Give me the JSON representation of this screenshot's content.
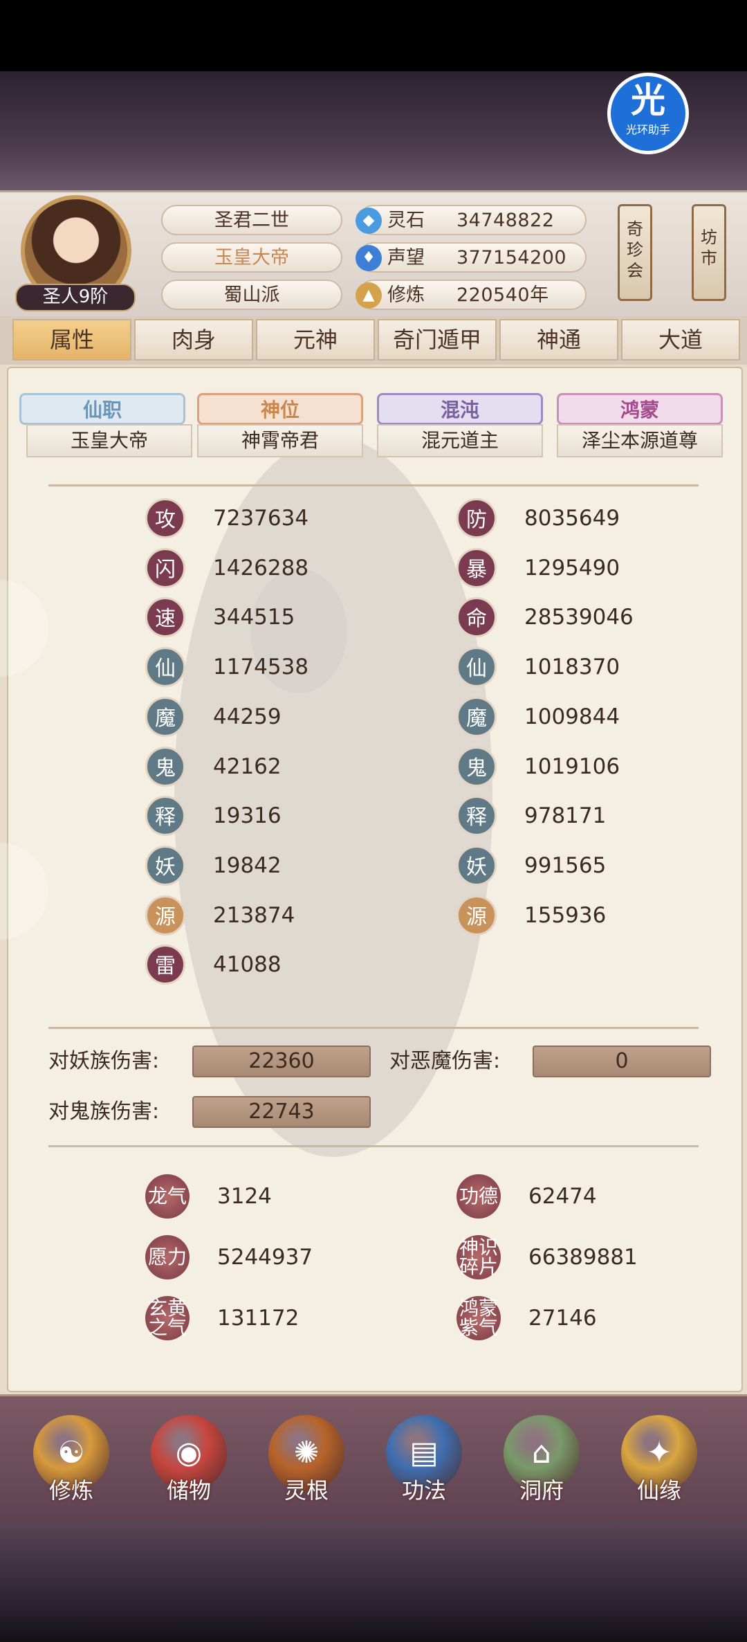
{
  "player": {
    "rank": "圣人9阶",
    "name_line1": "圣君二世",
    "name_line2": "玉皇大帝",
    "sect": "蜀山派"
  },
  "resources": [
    {
      "label": "灵石",
      "value": "34748822",
      "icon": "spirit-stone-icon",
      "color": "#4a9be0"
    },
    {
      "label": "声望",
      "value": "377154200",
      "icon": "reputation-icon",
      "color": "#3d7fd6"
    },
    {
      "label": "修炼",
      "value": "220540年",
      "icon": "cultivation-icon",
      "color": "#d4a24c"
    }
  ],
  "side_buttons": {
    "treasure": "奇珍会",
    "market": "坊市"
  },
  "badge": {
    "char": "光",
    "caption": "光环助手"
  },
  "tabs": [
    "属性",
    "肉身",
    "元神",
    "奇门遁甲",
    "神通",
    "大道"
  ],
  "titles": [
    {
      "label": "仙职",
      "value": "玉皇大帝",
      "color": "#6b95b8"
    },
    {
      "label": "神位",
      "value": "神霄帝君",
      "color": "#c9874f"
    },
    {
      "label": "混沌",
      "value": "混元道主",
      "color": "#7a5fa0"
    },
    {
      "label": "鸿蒙",
      "value": "泽尘本源道尊",
      "color": "#a24a8c"
    }
  ],
  "stats_left": [
    {
      "icon": "攻",
      "value": "7237634",
      "color": "#7a3a4f"
    },
    {
      "icon": "闪",
      "value": "1426288",
      "color": "#7a3a4f"
    },
    {
      "icon": "速",
      "value": "344515",
      "color": "#7a3a4f"
    },
    {
      "icon": "仙",
      "value": "1174538",
      "color": "#5f7a86"
    },
    {
      "icon": "魔",
      "value": "44259",
      "color": "#5f7a86"
    },
    {
      "icon": "鬼",
      "value": "42162",
      "color": "#5f7a86"
    },
    {
      "icon": "释",
      "value": "19316",
      "color": "#5f7a86"
    },
    {
      "icon": "妖",
      "value": "19842",
      "color": "#5f7a86"
    },
    {
      "icon": "源",
      "value": "213874",
      "color": "#c9925a"
    },
    {
      "icon": "雷",
      "value": "41088",
      "color": "#7a3a4f"
    }
  ],
  "stats_right": [
    {
      "icon": "防",
      "value": "8035649",
      "color": "#7a3a4f"
    },
    {
      "icon": "暴",
      "value": "1295490",
      "color": "#7a3a4f"
    },
    {
      "icon": "命",
      "value": "28539046",
      "color": "#7a3a4f"
    },
    {
      "icon": "仙",
      "value": "1018370",
      "color": "#5f7a86"
    },
    {
      "icon": "魔",
      "value": "1009844",
      "color": "#5f7a86"
    },
    {
      "icon": "鬼",
      "value": "1019106",
      "color": "#5f7a86"
    },
    {
      "icon": "释",
      "value": "978171",
      "color": "#5f7a86"
    },
    {
      "icon": "妖",
      "value": "991565",
      "color": "#5f7a86"
    },
    {
      "icon": "源",
      "value": "155936",
      "color": "#c9925a"
    }
  ],
  "damage": [
    {
      "label": "对妖族伤害:",
      "value": "22360"
    },
    {
      "label": "对恶魔伤害:",
      "value": "0"
    },
    {
      "label": "对鬼族伤害:",
      "value": "22743"
    }
  ],
  "misc_left": [
    {
      "icon": "龙气",
      "value": "3124"
    },
    {
      "icon": "愿力",
      "value": "5244937"
    },
    {
      "icon": "玄黄之气",
      "value": "131172"
    }
  ],
  "misc_right": [
    {
      "icon": "功德",
      "value": "62474"
    },
    {
      "icon": "神识碎片",
      "value": "66389881"
    },
    {
      "icon": "鸿蒙紫气",
      "value": "27146"
    }
  ],
  "nav": [
    {
      "label": "修炼",
      "icon": "cultivate-icon",
      "color": "#d79a3c"
    },
    {
      "label": "储物",
      "icon": "storage-bag-icon",
      "color": "#c8463f"
    },
    {
      "label": "灵根",
      "icon": "spirit-root-icon",
      "color": "#b8642a"
    },
    {
      "label": "功法",
      "icon": "manual-book-icon",
      "color": "#3f6fb0"
    },
    {
      "label": "洞府",
      "icon": "cave-house-icon",
      "color": "#7a9a6a"
    },
    {
      "label": "仙缘",
      "icon": "fate-gourd-icon",
      "color": "#d9a640"
    }
  ]
}
